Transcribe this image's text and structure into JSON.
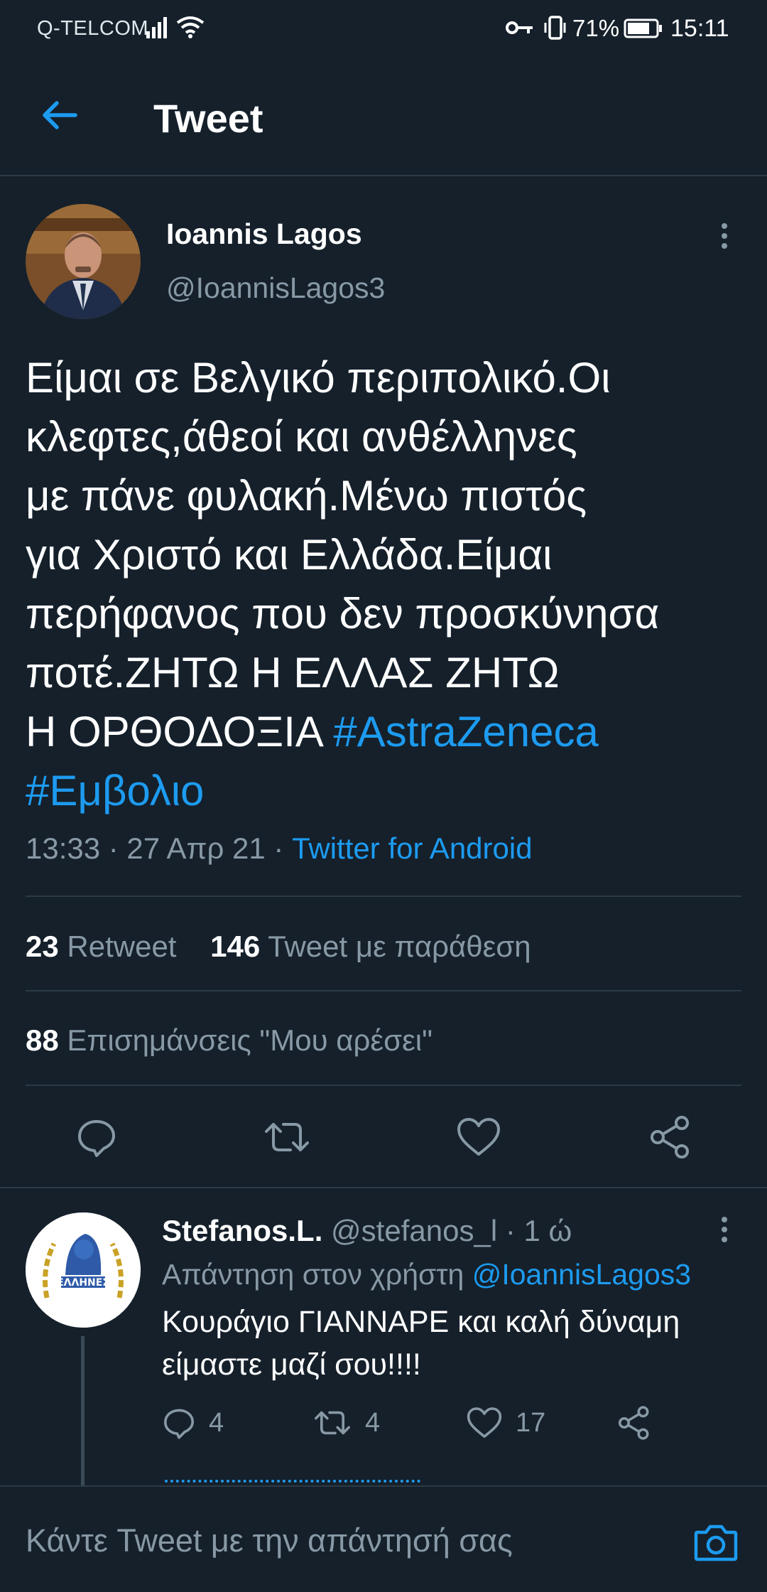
{
  "status_bar": {
    "carrier": "Q-TELCOM",
    "battery": "71%",
    "time": "15:11"
  },
  "header": {
    "title": "Tweet"
  },
  "tweet": {
    "author_name": "Ioannis Lagos",
    "author_handle": "@IoannisLagos3",
    "text": "Είμαι σε Βελγικό περιπολικό.Οι\nκλεφτες,άθεοί και ανθέλληνες\nμε πάνε  φυλακή.Μένω πιστός\nγια Χριστό και Ελλάδα.Είμαι\nπερήφανος που δεν προσκύνησα\nποτέ.ΖΗΤΩ Η ΕΛΛΑΣ ΖΗΤΩ\nΗ ΟΡΘΟΔΟΞΙΑ ",
    "hashtag_1": "#AstraZeneca",
    "hashtag_2": "#Εμβολιο",
    "timestamp": "13:33 · 27 Απρ 21 · ",
    "source": "Twitter for Android"
  },
  "stats": {
    "retweets_count": "23",
    "retweets_label": "Retweet",
    "quotes_count": "146",
    "quotes_label": "Tweet με παράθεση",
    "likes_count": "88",
    "likes_label": "Επισημάνσεις \"Μου αρέσει\""
  },
  "reply": {
    "name": "Stefanos.L.",
    "handle_time": "@stefanos_l · 1 ώ",
    "reply_to_label": "Απάντηση στον χρήστη ",
    "reply_to_handle": "@IoannisLagos3",
    "text": "Κουράγιο ΓΙΑΝΝΑΡΕ και καλή δύναμη είμαστε μαζί σου!!!!",
    "replies": "4",
    "retweets": "4",
    "likes": "17",
    "avatar_text": "ΕΛΛΗΝΕΣ"
  },
  "compose": {
    "placeholder": "Κάντε Tweet με την απάντησή σας"
  },
  "colors": {
    "background": "#15202b",
    "accent": "#1d9bf0",
    "secondary_text": "#8899a6",
    "divider": "#2b3a47"
  },
  "icons": [
    "signal-icon",
    "wifi-icon",
    "key-icon",
    "vibrate-icon",
    "battery-icon",
    "back-arrow-icon",
    "more-vertical-icon",
    "reply-icon",
    "retweet-icon",
    "like-icon",
    "share-icon",
    "camera-icon"
  ]
}
